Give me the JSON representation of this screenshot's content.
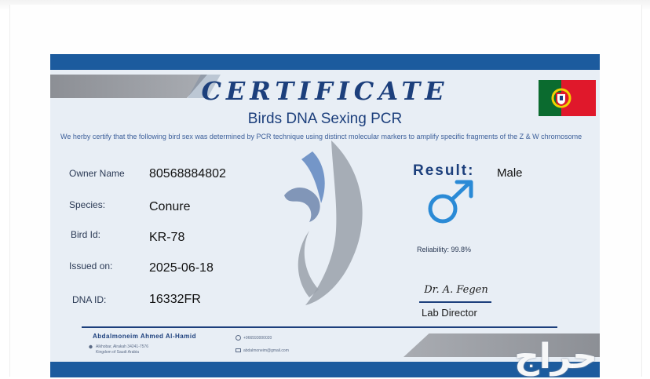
{
  "certificate": {
    "title": "CERTIFICATE",
    "subtitle": "Birds DNA Sexing PCR",
    "statement": "We herby certify that the following bird sex was determined by PCR technique using distinct molecular markers to amplify specific fragments of the Z & W chromosome",
    "flag_country": "Portugal",
    "fields": [
      {
        "label": "Owner Name",
        "value": "80568884802"
      },
      {
        "label": "Species:",
        "value": "Conure"
      },
      {
        "label": "Bird Id:",
        "value": "KR-78"
      },
      {
        "label": "Issued on:",
        "value": "2025-06-18"
      },
      {
        "label": "DNA ID:",
        "value": "16332FR"
      }
    ],
    "result": {
      "label": "Result:",
      "value": "Male",
      "icon": "male-symbol-icon",
      "reliability": "Reliability: 99.8%"
    },
    "signature": {
      "text": "Dr. A. Fegen",
      "title": "Lab Director"
    },
    "footer": {
      "name": "Abdalmoneim Ahmed Al-Hamid",
      "phone": "+966593000020",
      "email": "abdalmoneim@gmail.com",
      "address_line1": "Alkhobar, Alrakah 34241-7576",
      "address_line2": "Kingdom of Saudi Arabia"
    }
  },
  "watermark": {
    "source_logo": "حراج"
  },
  "colors": {
    "accent": "#1c3f7c",
    "band": "#1c5b9e",
    "background": "#e8eef5",
    "male_symbol": "#2a8ad6"
  }
}
